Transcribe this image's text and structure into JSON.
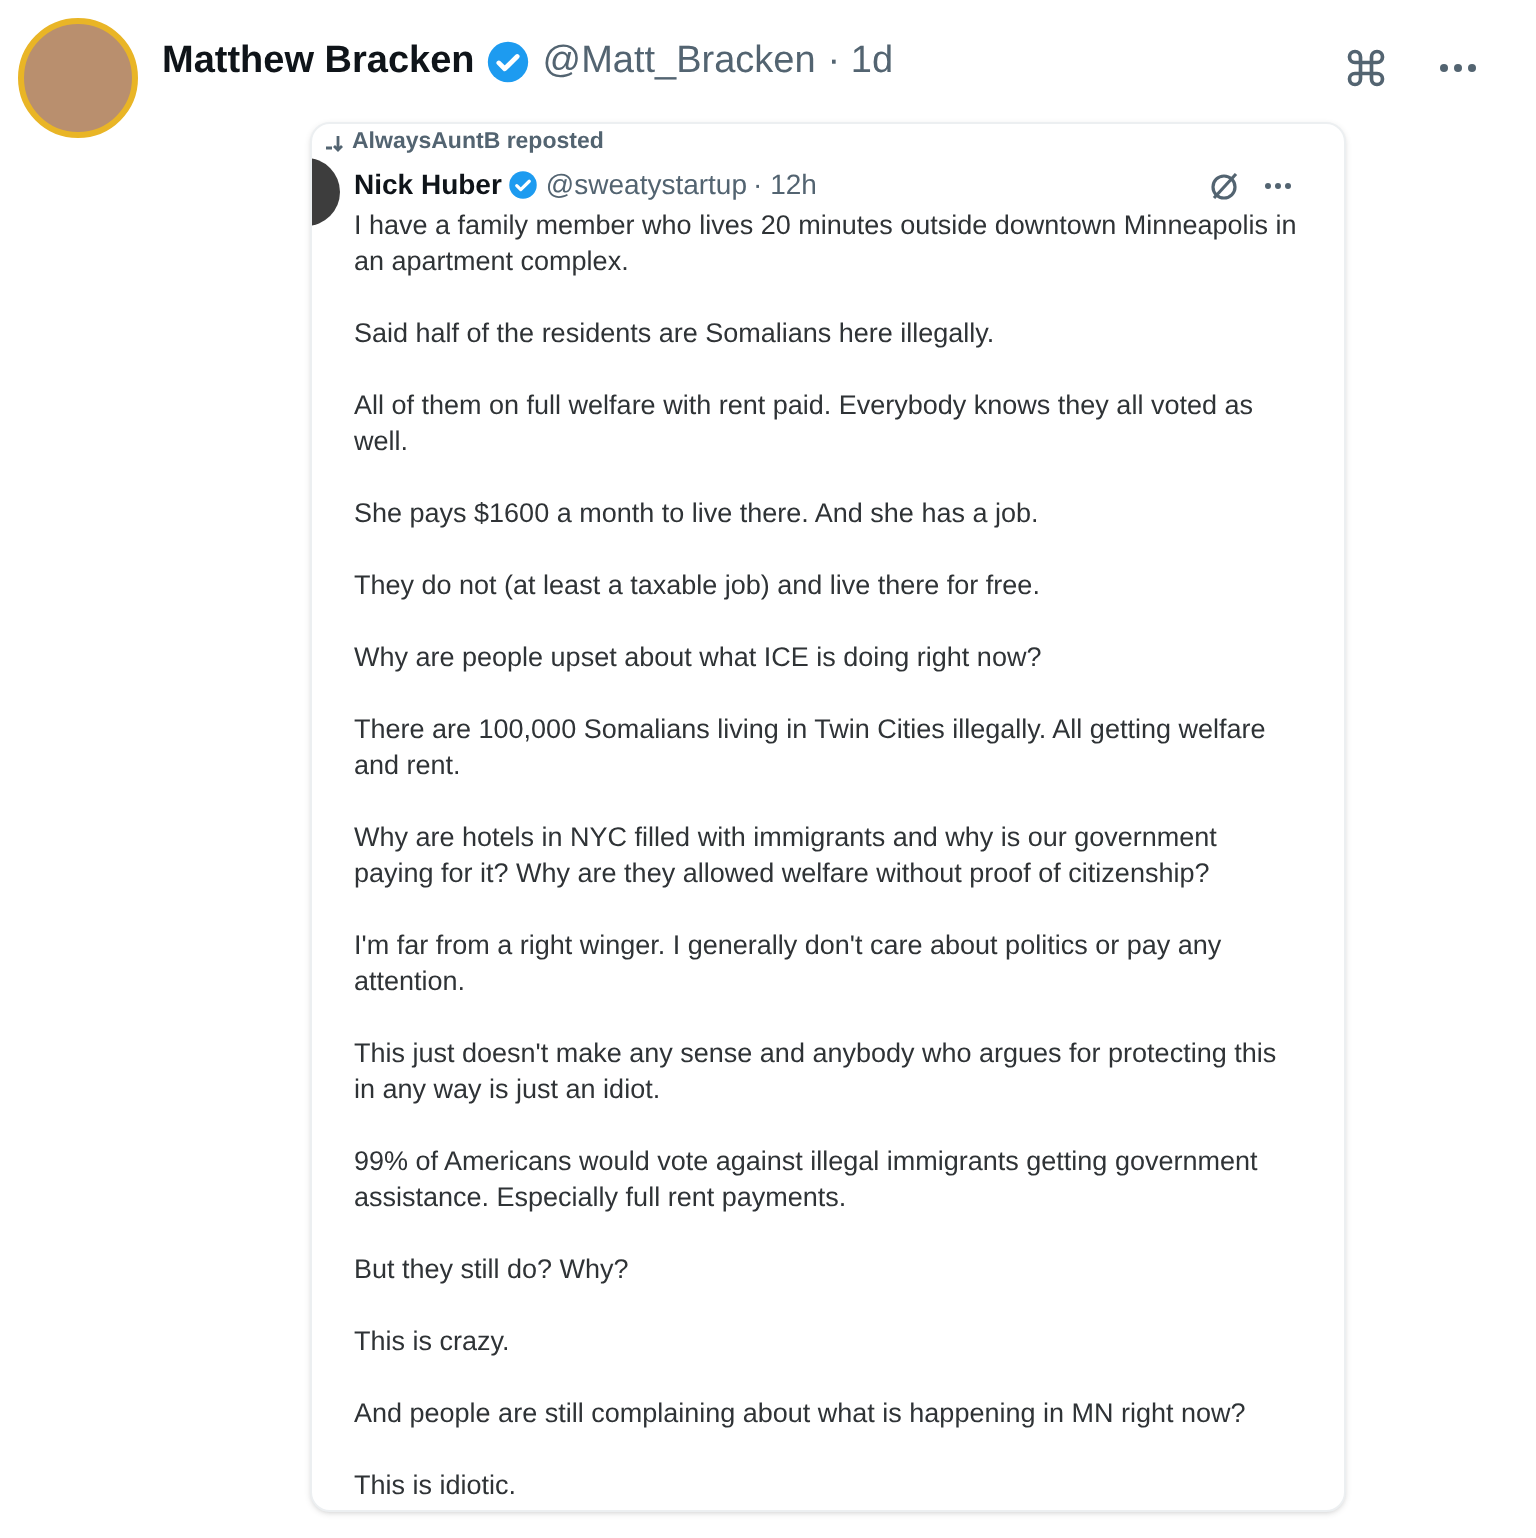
{
  "post": {
    "name": "Matthew Bracken",
    "verified": true,
    "handle": "@Matt_Bracken",
    "time": "· 1d"
  },
  "embed": {
    "repost_label": "AlwaysAuntB reposted",
    "name": "Nick Huber",
    "verified": true,
    "handle": "@sweatystartup",
    "time": "· 12h",
    "paragraphs": [
      "I have a family member who lives 20 minutes outside downtown Minneapolis in an apartment complex.",
      "Said half of the residents are Somalians here illegally.",
      "All of them on full welfare with rent paid. Everybody knows they all voted as well.",
      "She pays $1600 a month to live there. And she has a job.",
      "They do not (at least a taxable job) and live there for free.",
      "Why are people upset about what ICE is doing right now?",
      "There are 100,000 Somalians living in Twin Cities illegally. All getting welfare and rent.",
      "Why are hotels in NYC filled with immigrants and why is our government paying for it? Why are they allowed welfare without proof of citizenship?",
      "I'm far from a right winger. I generally don't care about politics or pay any attention.",
      "This just doesn't make any sense and anybody who argues for protecting this in any way is just an idiot.",
      "99% of Americans would vote against illegal immigrants getting government assistance. Especially full rent payments.",
      "But they still do? Why?",
      "This is crazy.",
      "And people are still complaining about what is happening in MN right now?",
      "This is idiotic."
    ]
  }
}
